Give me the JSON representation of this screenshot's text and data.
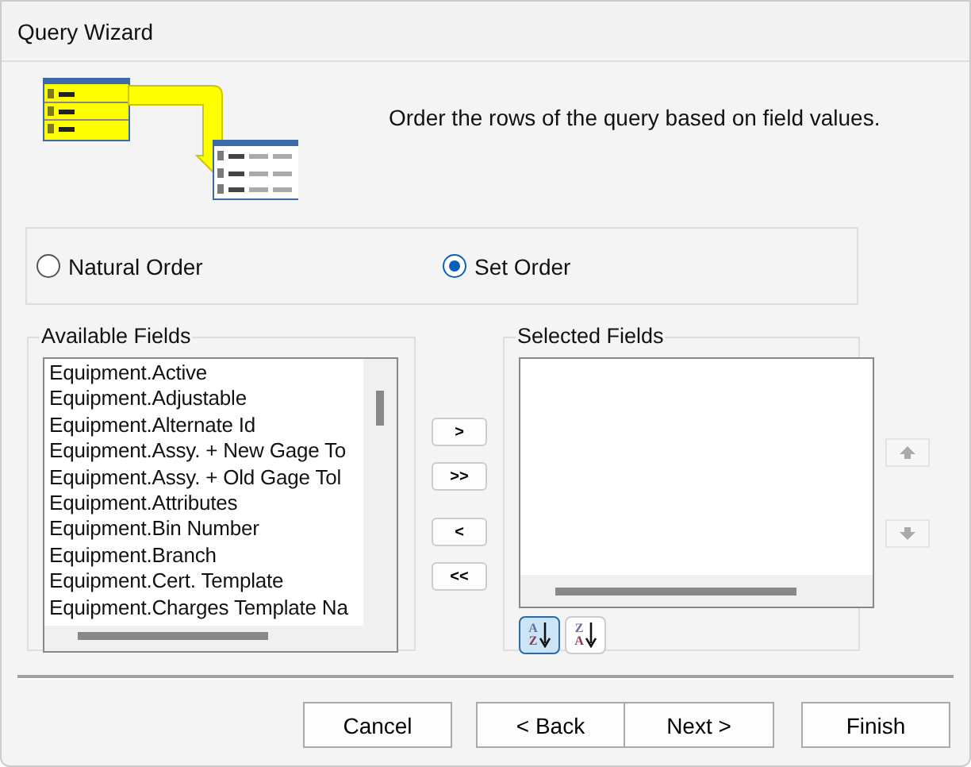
{
  "window": {
    "title": "Query Wizard"
  },
  "instruction": "Order the rows of the query based on field values.",
  "order_options": [
    {
      "label": "Natural Order",
      "selected": false
    },
    {
      "label": "Set Order",
      "selected": true
    }
  ],
  "available_fields": {
    "title": "Available Fields",
    "items": [
      "Equipment.Active",
      "Equipment.Adjustable",
      "Equipment.Alternate Id",
      "Equipment.Assy. + New Gage To",
      "Equipment.Assy. + Old Gage Tol",
      "Equipment.Attributes",
      "Equipment.Bin Number",
      "Equipment.Branch",
      "Equipment.Cert. Template",
      "Equipment.Charges Template Na"
    ]
  },
  "move_buttons": [
    ">",
    ">>",
    "<",
    "<<"
  ],
  "selected_fields": {
    "title": "Selected Fields"
  },
  "sort_buttons": [
    {
      "top": "A",
      "bottom": "Z",
      "selected": true
    },
    {
      "top": "Z",
      "bottom": "A",
      "selected": false
    }
  ],
  "buttons": [
    "Cancel",
    "< Back",
    "Next >",
    "Finish"
  ]
}
